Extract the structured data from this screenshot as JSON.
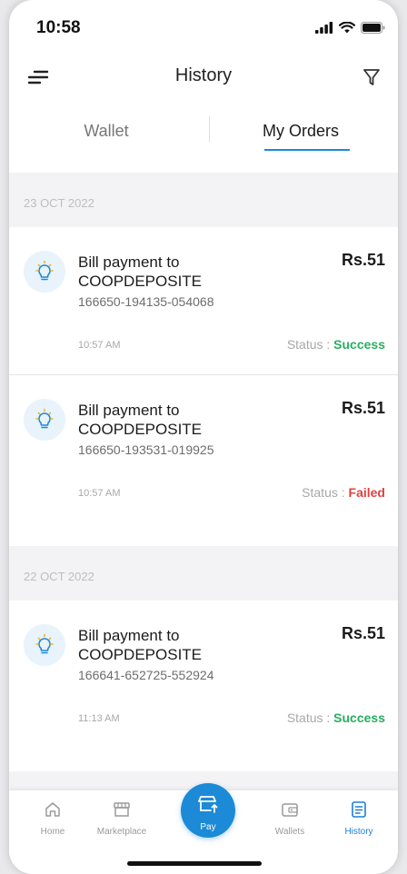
{
  "status_bar": {
    "time": "10:58"
  },
  "header": {
    "title": "History",
    "menu_icon": "menu-icon",
    "filter_icon": "filter-icon"
  },
  "tabs": [
    {
      "label": "Wallet",
      "active": false
    },
    {
      "label": "My Orders",
      "active": true
    }
  ],
  "sections": [
    {
      "date": "23 OCT 2022",
      "orders": [
        {
          "title_line1": "Bill payment to",
          "title_line2": "COOPDEPOSITE",
          "amount": "Rs.51",
          "ref": "166650-194135-054068",
          "time": "10:57 AM",
          "status_label": "Status : ",
          "status_value": "Success"
        },
        {
          "title_line1": "Bill payment to",
          "title_line2": "COOPDEPOSITE",
          "amount": "Rs.51",
          "ref": "166650-193531-019925",
          "time": "10:57 AM",
          "status_label": "Status : ",
          "status_value": "Failed"
        }
      ]
    },
    {
      "date": "22 OCT 2022",
      "orders": [
        {
          "title_line1": "Bill payment to",
          "title_line2": "COOPDEPOSITE",
          "amount": "Rs.51",
          "ref": "166641-652725-552924",
          "time": "11:13 AM",
          "status_label": "Status : ",
          "status_value": "Success"
        }
      ]
    }
  ],
  "bottom_nav": [
    {
      "label": "Home",
      "icon": "home-icon",
      "active": false
    },
    {
      "label": "Marketplace",
      "icon": "marketplace-icon",
      "active": false
    },
    {
      "label": "Pay",
      "icon": "pay-icon",
      "active": false
    },
    {
      "label": "Wallets",
      "icon": "wallet-icon",
      "active": false
    },
    {
      "label": "History",
      "icon": "history-icon",
      "active": true
    }
  ],
  "colors": {
    "accent": "#1c8ad6",
    "success": "#27ae60",
    "failed": "#e0433f"
  }
}
